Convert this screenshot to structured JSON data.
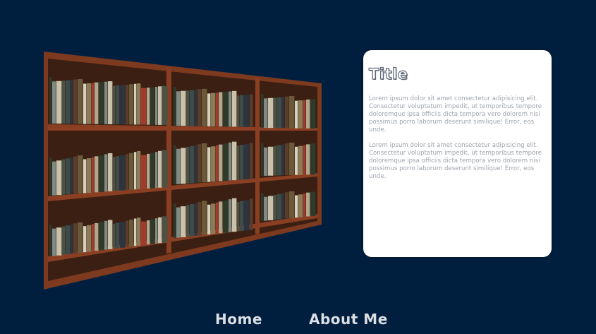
{
  "card": {
    "title": "Title",
    "paragraphs": [
      "Lorem ipsum dolor sit amet consectetur adipisicing elit. Consectetur voluptatum impedit, ut temporibus tempore doloremque ipsa officiis dicta tempora vero dolorem nisi possimus porro laborum deserunt similique! Error, eos unde.",
      "Lorem ipsum dolor sit amet consectetur adipisicing elit. Consectetur voluptatum impedit, ut temporibus tempore doloremque ipsa officiis dicta tempora vero dolorem nisi possimus porro laborum deserunt similique! Error, eos unde."
    ]
  },
  "nav": {
    "home": "Home",
    "about": "About Me"
  },
  "colors": {
    "background": "#001f3f",
    "card": "#ffffff",
    "shelf_wood": "#8a3f22"
  }
}
